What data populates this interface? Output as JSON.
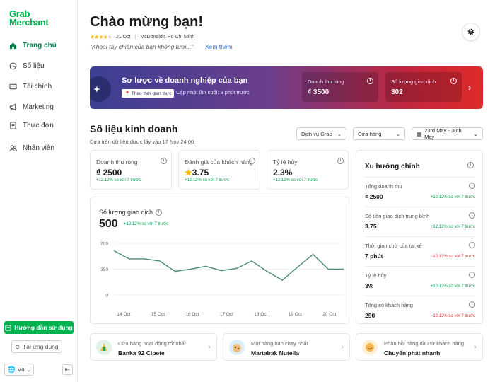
{
  "brand": {
    "line1": "Grab",
    "line2": "Merchant",
    "color": "#00b14f"
  },
  "sidebar": {
    "items": [
      {
        "label": "Trang chủ",
        "icon": "home-icon",
        "active": true
      },
      {
        "label": "Số liệu",
        "icon": "chart-icon"
      },
      {
        "label": "Tài chính",
        "icon": "wallet-icon"
      },
      {
        "label": "Marketing",
        "icon": "megaphone-icon"
      },
      {
        "label": "Thực đơn",
        "icon": "menu-book-icon"
      },
      {
        "label": "Nhân viên",
        "icon": "people-icon"
      }
    ],
    "guide_button": "Hướng dẫn sử dụng",
    "download_button": "Tải ứng dụng",
    "language": "Vn"
  },
  "header": {
    "welcome": "Chào mừng bạn!",
    "review_date": "21 Oct",
    "review_store": "McDonald's Ho Chi Minh",
    "review_rating": 4,
    "review_quote": "\"Khoai tây chiên của bạn không tươi...\"",
    "see_more": "Xem thêm"
  },
  "banner": {
    "title": "Sơ lược về doanh nghiệp của bạn",
    "live_badge": "Theo thời gian thực",
    "last_update": "Cập nhật lần cuối: 3 phút trước",
    "stats": [
      {
        "label": "Doanh thu ròng",
        "value": "₫ 3500"
      },
      {
        "label": "Số lượng giao dịch",
        "value": "302"
      }
    ]
  },
  "business": {
    "title": "Số liệu kinh doanh",
    "subtitle": "Dựa trên dữ liệu được lấy vào 17 Nov 24:00",
    "filters": {
      "service": "Dịch vụ Grab",
      "store": "Cửa hàng",
      "date_range": "23rd May - 30th May"
    },
    "kpis": [
      {
        "label": "Doanh thu ròng",
        "value": "₫ 2500",
        "change": "+12.12% so với 7 trước"
      },
      {
        "label": "Đánh giá của khách hàng",
        "value": "3.75",
        "change": "+12.12% so với 7 trước"
      },
      {
        "label": "Tỷ lệ hủy",
        "value": "2.3%",
        "change": "+12.12% so với 7 trước"
      }
    ],
    "transactions": {
      "label": "Số lượng giao dịch",
      "value": "500",
      "change": "+12.12% so với 7 trước"
    }
  },
  "chart_data": {
    "type": "line",
    "x": [
      "14 Oct",
      "",
      "15 Oct",
      "",
      "16 Oct",
      "",
      "17 Oct",
      "",
      "18 Oct",
      "",
      "19 Oct",
      "",
      "20 Oct",
      ""
    ],
    "y_ticks": [
      "700",
      "350",
      "0"
    ],
    "ylim": [
      0,
      700
    ],
    "series": [
      {
        "values": [
          600,
          490,
          490,
          460,
          320,
          350,
          390,
          330,
          360,
          460,
          320,
          200,
          380,
          550,
          350,
          350
        ]
      }
    ],
    "color": "#4a8a78"
  },
  "trends": {
    "title": "Xu hướng chính",
    "items": [
      {
        "label": "Tổng doanh thu",
        "value": "₫ 2500",
        "change": "+12.12% so với 7 trước",
        "dir": "pos"
      },
      {
        "label": "Số tiền giao dịch trung bình",
        "value": "3.75",
        "change": "+12.12% so với 7 trước",
        "dir": "pos"
      },
      {
        "label": "Thời gian chờ của tài xế",
        "value": "7 phút",
        "change": "-12.12% so với 7 trước",
        "dir": "neg"
      },
      {
        "label": "Tỷ lệ hủy",
        "value": "3%",
        "change": "+12.12% so với 7 trước",
        "dir": "pos"
      },
      {
        "label": "Tổng số khách hàng",
        "value": "290",
        "change": "-12.12% so với 7 trước",
        "dir": "neg"
      }
    ]
  },
  "highlights": [
    {
      "label": "Cửa hàng hoạt động tốt nhất",
      "value": "Banka 92 Cipete"
    },
    {
      "label": "Mặt hàng bán chạy nhất",
      "value": "Martabak Nutella"
    },
    {
      "label": "Phản hồi hàng đầu từ khách hàng",
      "value": "Chuyển phát nhanh"
    }
  ]
}
